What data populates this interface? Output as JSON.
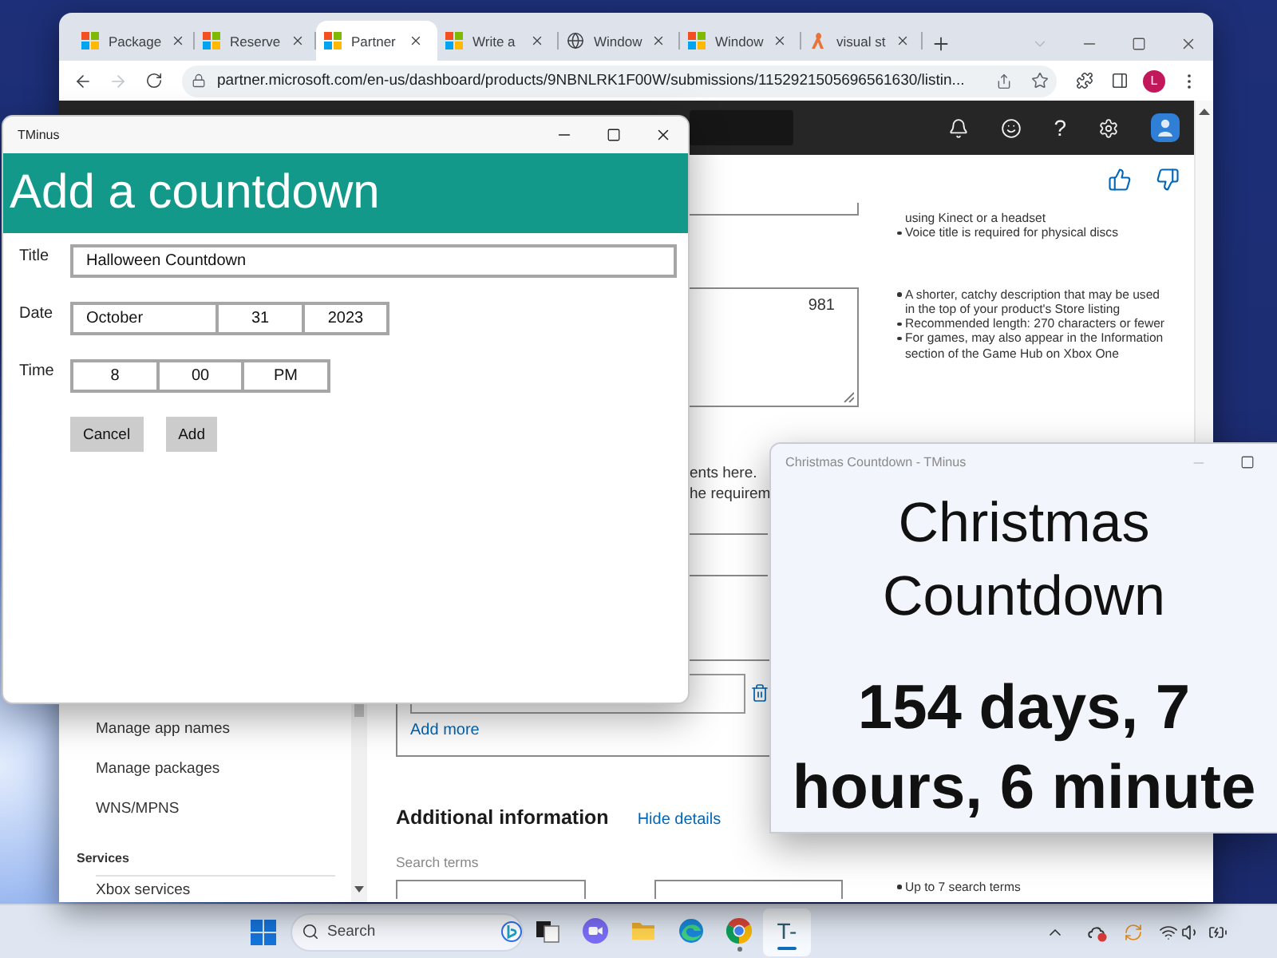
{
  "browser": {
    "tabs": [
      {
        "label": "Package",
        "kind": "tiles",
        "selected": false
      },
      {
        "label": "Reserve",
        "kind": "tiles",
        "selected": false
      },
      {
        "label": "Partner",
        "kind": "tiles",
        "selected": true
      },
      {
        "label": "Write a",
        "kind": "tiles",
        "selected": false
      },
      {
        "label": "Window",
        "kind": "globe",
        "selected": false
      },
      {
        "label": "Window",
        "kind": "tiles",
        "selected": false
      },
      {
        "label": "visual st",
        "kind": "figure",
        "selected": false
      }
    ],
    "forward_disabled": true,
    "url": "partner.microsoft.com/en-us/dashboard/products/9NBNLRK1F00W/submissions/1152921505696561630/listin...",
    "profile_initial": "L",
    "header": {
      "help": "?"
    },
    "sidebar": {
      "items": [
        "Manage app names",
        "Manage packages",
        "WNS/MPNS"
      ],
      "section": "Services",
      "section_items": [
        "Xbox services"
      ]
    },
    "content": {
      "voice_notes": [
        {
          "kind": "continuation",
          "text": "using Kinect or a headset"
        },
        {
          "kind": "bullet",
          "text": "Voice title is required for physical discs"
        }
      ],
      "description": {
        "counter": "981",
        "notes": [
          {
            "kind": "bullet",
            "text": "A shorter, catchy description that may be used in the top of your product's Store listing"
          },
          {
            "kind": "bullet",
            "text": "Recommended length: 270 characters or fewer"
          },
          {
            "kind": "bullet",
            "text": "For games, may also appear in the Information section of the Game Hub on Xbox One"
          }
        ]
      },
      "fragment_lines": [
        "ents here.",
        "he requirem"
      ],
      "add_more": "Add more",
      "additional": {
        "heading": "Additional information",
        "toggle": "Hide details",
        "search_label": "Search terms",
        "notes": [
          {
            "kind": "bullet",
            "text": "Up to 7 search terms"
          }
        ]
      }
    }
  },
  "editor": {
    "title": "TMinus",
    "heading": "Add a countdown",
    "fields": [
      {
        "kind": "text",
        "label": "Title",
        "value": "Halloween Countdown"
      },
      {
        "kind": "date",
        "label": "Date",
        "parts": [
          "October",
          "31",
          "2023"
        ]
      },
      {
        "kind": "time",
        "label": "Time",
        "parts": [
          "8",
          "00",
          "PM"
        ]
      }
    ],
    "buttons": [
      "Cancel",
      "Add"
    ]
  },
  "countdown_window": {
    "title": "Christmas Countdown - TMinus",
    "heading": "Christmas Countdown",
    "remaining": "154 days, 7 hours, 6 minute"
  },
  "taskbar": {
    "placeholder": "Search",
    "apps": [
      {
        "kind": "task-view",
        "open": false,
        "selected": false
      },
      {
        "kind": "chat",
        "open": false,
        "selected": false
      },
      {
        "kind": "folder",
        "open": false,
        "selected": false
      },
      {
        "kind": "edge",
        "open": false,
        "selected": false
      },
      {
        "kind": "chrome",
        "open": true,
        "selected": false
      },
      {
        "kind": "text",
        "label": "T-",
        "open": true,
        "selected": true
      }
    ]
  }
}
